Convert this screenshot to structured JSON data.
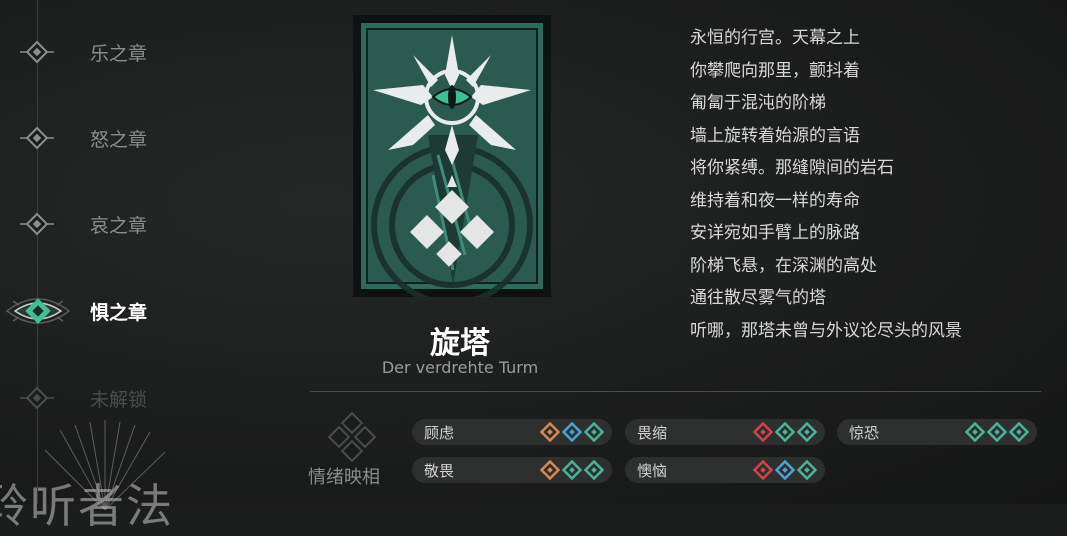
{
  "chapters": [
    {
      "label": "乐之章",
      "state": "normal"
    },
    {
      "label": "怒之章",
      "state": "normal"
    },
    {
      "label": "哀之章",
      "state": "normal"
    },
    {
      "label": "惧之章",
      "state": "active"
    },
    {
      "label": "未解锁",
      "state": "locked"
    }
  ],
  "card": {
    "title": "旋塔",
    "subtitle": "Der verdrehte Turm"
  },
  "poem": [
    "永恒的行宫。天幕之上",
    "你攀爬向那里，颤抖着",
    "匍匐于混沌的阶梯",
    "墙上旋转着始源的言语",
    "将你紧缚。那缝隙间的岩石",
    "维持着和夜一样的寿命",
    "安详宛如手臂上的脉路",
    "阶梯飞悬，在深渊的高处",
    "通往散尽雾气的塔",
    "听哪，那塔未曾与外议论尽头的风景"
  ],
  "emotion": {
    "section_label": "情绪映相",
    "tags": [
      {
        "name": "顾虑",
        "gems": [
          "orange",
          "blue",
          "green"
        ]
      },
      {
        "name": "畏缩",
        "gems": [
          "red",
          "green",
          "green"
        ]
      },
      {
        "name": "惊恐",
        "gems": [
          "green",
          "green",
          "green"
        ]
      },
      {
        "name": "敬畏",
        "gems": [
          "orange",
          "green",
          "green"
        ]
      },
      {
        "name": "懊恼",
        "gems": [
          "red",
          "blue",
          "green"
        ]
      }
    ]
  },
  "colors": {
    "orange": "#d8874e",
    "blue": "#4aa3d6",
    "green": "#49b39a",
    "red": "#d2444a",
    "accent": "#3fbf94"
  },
  "watermark": "聆听者法"
}
